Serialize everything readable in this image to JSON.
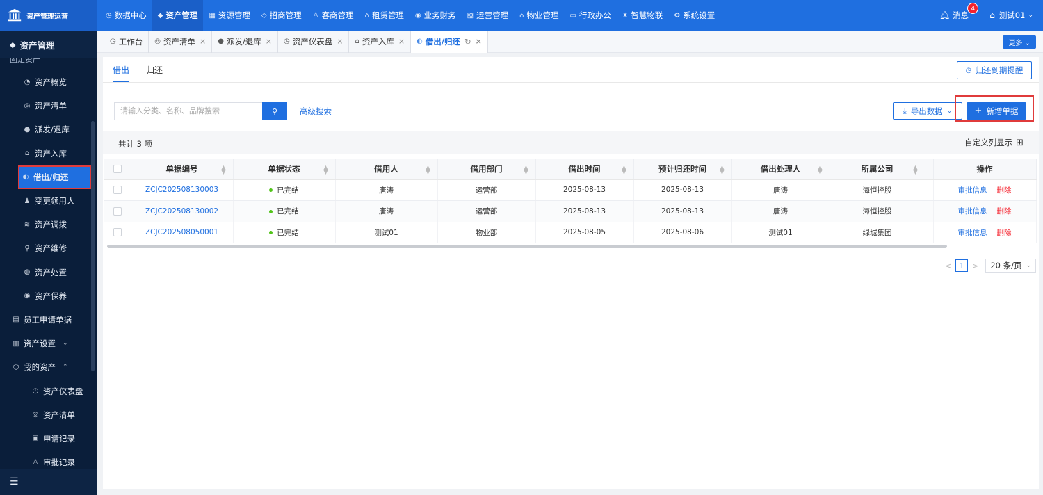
{
  "brand": {
    "title": "资产管理运营"
  },
  "topnav": [
    {
      "label": "数据中心",
      "icon": "clock-icon",
      "active": false
    },
    {
      "label": "资产管理",
      "icon": "cube-icon",
      "active": true
    },
    {
      "label": "资源管理",
      "icon": "building-icon",
      "active": false
    },
    {
      "label": "招商管理",
      "icon": "tag-icon",
      "active": false
    },
    {
      "label": "客商管理",
      "icon": "users-icon",
      "active": false
    },
    {
      "label": "租赁管理",
      "icon": "home-icon",
      "active": false
    },
    {
      "label": "业务财务",
      "icon": "coin-icon",
      "active": false
    },
    {
      "label": "运营管理",
      "icon": "chart-icon",
      "active": false
    },
    {
      "label": "物业管理",
      "icon": "house-icon",
      "active": false
    },
    {
      "label": "行政办公",
      "icon": "monitor-icon",
      "active": false
    },
    {
      "label": "智慧物联",
      "icon": "chip-icon",
      "active": false
    },
    {
      "label": "系统设置",
      "icon": "gear-icon",
      "active": false
    }
  ],
  "header": {
    "messages_label": "消息",
    "messages_count": "4",
    "user": "测试01"
  },
  "sidebar": {
    "title": "资产管理",
    "cut_item": "固定资产",
    "items": [
      {
        "label": "资产概览",
        "icon": "◔"
      },
      {
        "label": "资产清单",
        "icon": "◎"
      },
      {
        "label": "派发/退库",
        "icon": "●"
      },
      {
        "label": "资产入库",
        "icon": "⌂"
      },
      {
        "label": "借出/归还",
        "icon": "◐",
        "active": true
      },
      {
        "label": "变更领用人",
        "icon": "♟"
      },
      {
        "label": "资产调拨",
        "icon": "≋"
      },
      {
        "label": "资产维修",
        "icon": "⚲"
      },
      {
        "label": "资产处置",
        "icon": "◍"
      },
      {
        "label": "资产保养",
        "icon": "◉"
      },
      {
        "label": "员工申请单据",
        "icon": "▤",
        "group": true
      },
      {
        "label": "资产设置",
        "icon": "▥",
        "group": true,
        "caret": "⌄"
      },
      {
        "label": "我的资产",
        "icon": "⬡",
        "group": true,
        "caret": "⌃"
      },
      {
        "label": "资产仪表盘",
        "icon": "◷",
        "sub": true
      },
      {
        "label": "资产清单",
        "icon": "◎",
        "sub": true
      },
      {
        "label": "申请记录",
        "icon": "▣",
        "sub": true
      },
      {
        "label": "审批记录",
        "icon": "♙",
        "sub": true
      }
    ]
  },
  "tabs": [
    {
      "label": "工作台",
      "icon": "◷",
      "closable": false
    },
    {
      "label": "资产清单",
      "icon": "◎",
      "closable": true
    },
    {
      "label": "派发/退库",
      "icon": "●",
      "closable": true
    },
    {
      "label": "资产仪表盘",
      "icon": "◷",
      "closable": true
    },
    {
      "label": "资产入库",
      "icon": "⌂",
      "closable": true
    },
    {
      "label": "借出/归还",
      "icon": "◐",
      "closable": true,
      "active": true
    }
  ],
  "more_label": "更多",
  "subtabs": [
    {
      "label": "借出",
      "active": true
    },
    {
      "label": "归还",
      "active": false
    }
  ],
  "remind_label": "归还到期提醒",
  "search": {
    "placeholder": "请输入分类、名称、品牌搜索"
  },
  "advanced_search": "高级搜索",
  "export_label": "导出数据",
  "add_label": "新增单据",
  "total_label": "共计 3 项",
  "column_settings": "自定义列显示",
  "table": {
    "columns": [
      "单据编号",
      "单据状态",
      "借用人",
      "借用部门",
      "借出时间",
      "预计归还时间",
      "借出处理人",
      "所属公司",
      "操作"
    ],
    "rows": [
      {
        "code": "ZCJC202508130003",
        "status": "已完结",
        "borrower": "唐涛",
        "dept": "运营部",
        "out_time": "2025-08-13",
        "return_time": "2025-08-13",
        "handler": "唐涛",
        "company": "海恒控股"
      },
      {
        "code": "ZCJC202508130002",
        "status": "已完结",
        "borrower": "唐涛",
        "dept": "运营部",
        "out_time": "2025-08-13",
        "return_time": "2025-08-13",
        "handler": "唐涛",
        "company": "海恒控股"
      },
      {
        "code": "ZCJC202508050001",
        "status": "已完结",
        "borrower": "测试01",
        "dept": "物业部",
        "out_time": "2025-08-05",
        "return_time": "2025-08-06",
        "handler": "测试01",
        "company": "绿城集团"
      }
    ],
    "action_view": "审批信息",
    "action_delete": "删除"
  },
  "pager": {
    "page": "1",
    "size": "20 条/页"
  },
  "colors": {
    "primary": "#1f6fe0",
    "sidebar": "#0a1e3a",
    "danger": "#f5222d",
    "success": "#52c41a"
  }
}
